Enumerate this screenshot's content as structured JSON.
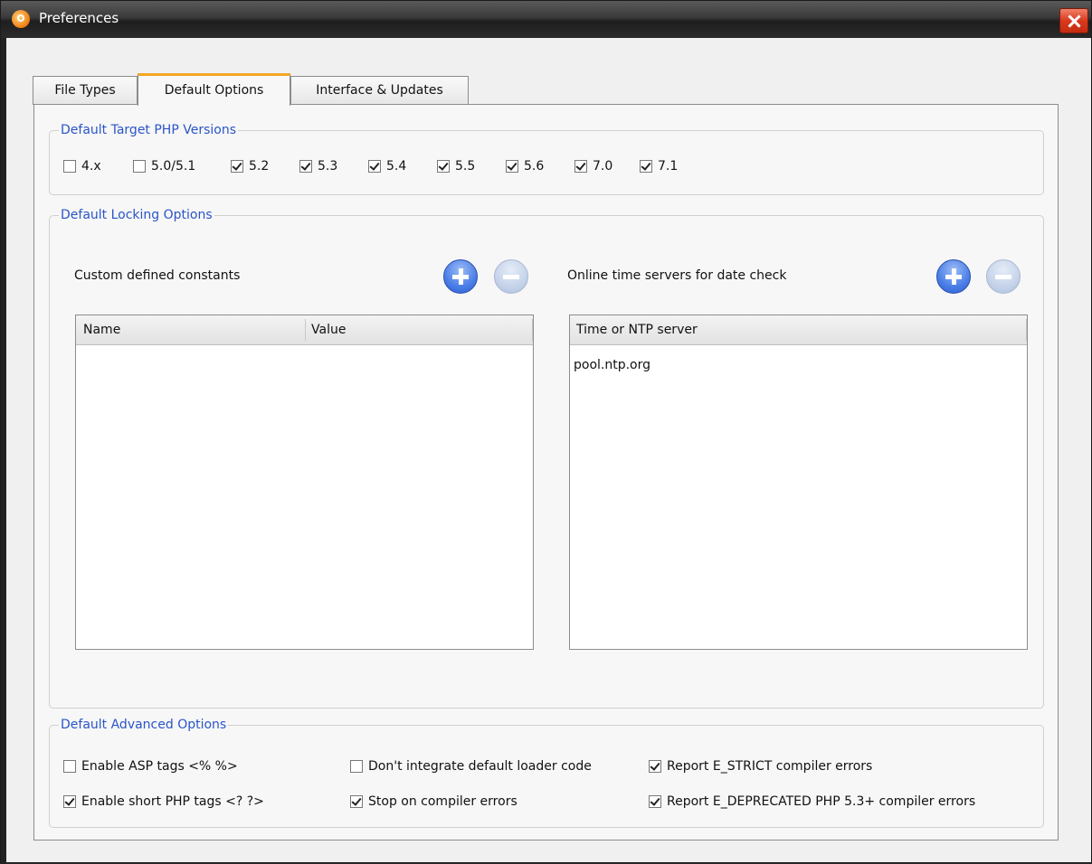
{
  "window": {
    "title": "Preferences"
  },
  "tabs": [
    {
      "label": "File Types",
      "active": false
    },
    {
      "label": "Default Options",
      "active": true
    },
    {
      "label": "Interface & Updates",
      "active": false
    }
  ],
  "php_versions": {
    "legend": "Default Target PHP Versions",
    "items": [
      {
        "label": "4.x",
        "checked": false
      },
      {
        "label": "5.0/5.1",
        "checked": false
      },
      {
        "label": "5.2",
        "checked": true
      },
      {
        "label": "5.3",
        "checked": true
      },
      {
        "label": "5.4",
        "checked": true
      },
      {
        "label": "5.5",
        "checked": true
      },
      {
        "label": "5.6",
        "checked": true
      },
      {
        "label": "7.0",
        "checked": true
      },
      {
        "label": "7.1",
        "checked": true
      }
    ]
  },
  "locking": {
    "legend": "Default Locking Options",
    "constants": {
      "label": "Custom defined constants",
      "columns": [
        "Name",
        "Value"
      ],
      "rows": []
    },
    "time_servers": {
      "label": "Online time servers for date check",
      "columns": [
        "Time or NTP server"
      ],
      "rows": [
        "pool.ntp.org"
      ]
    }
  },
  "advanced": {
    "legend": "Default Advanced Options",
    "items": [
      {
        "label": "Enable ASP tags <% %>",
        "checked": false
      },
      {
        "label": "Enable short PHP tags <? ?>",
        "checked": true
      },
      {
        "label": "Don't integrate default loader code",
        "checked": false
      },
      {
        "label": "Stop on compiler errors",
        "checked": true
      },
      {
        "label": "Report E_STRICT compiler errors",
        "checked": true
      },
      {
        "label": "Report E_DEPRECATED PHP 5.3+ compiler errors",
        "checked": true
      }
    ]
  },
  "colors": {
    "legend": "#2a55c8",
    "active_tab_accent": "#f5a623",
    "add_button": "#4a7de6",
    "close_button": "#d9391c"
  }
}
